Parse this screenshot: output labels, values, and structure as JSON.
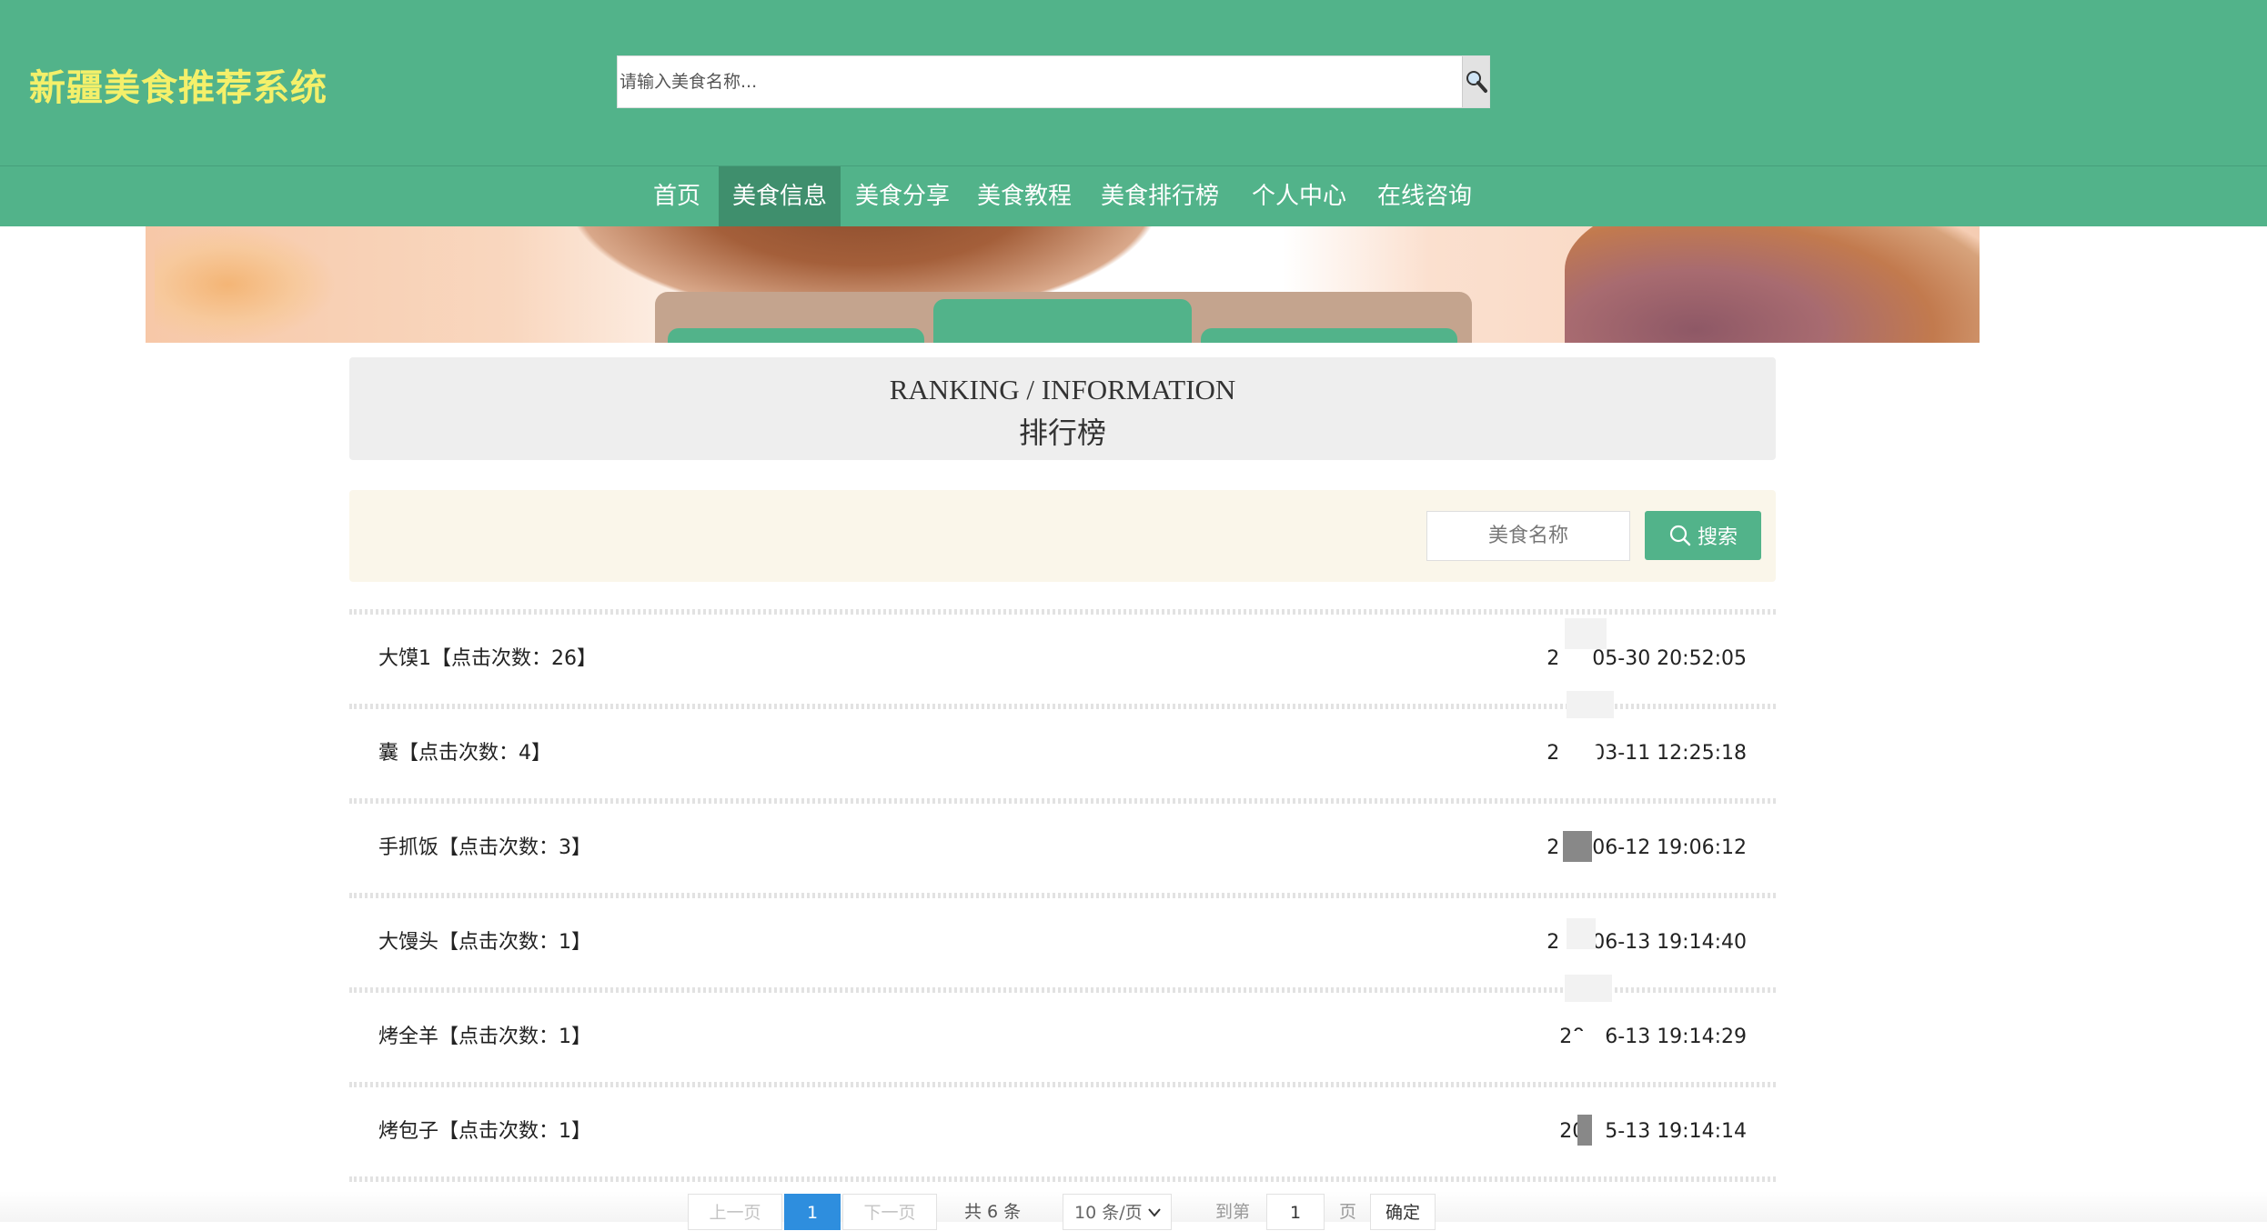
{
  "header": {
    "site_title": "新疆美食推荐系统",
    "search_placeholder": "请输入美食名称..."
  },
  "nav": {
    "items": [
      {
        "label": "首页"
      },
      {
        "label": "美食信息",
        "active": true
      },
      {
        "label": "美食分享"
      },
      {
        "label": "美食教程"
      },
      {
        "label": "美食排行榜"
      },
      {
        "label": "个人中心"
      },
      {
        "label": "在线咨询"
      }
    ]
  },
  "section": {
    "title_en": "RANKING / INFORMATION",
    "title_cn": "排行榜"
  },
  "filter": {
    "placeholder": "美食名称",
    "button_label": "搜索"
  },
  "list": {
    "rows": [
      {
        "title": "大馍1【点击次数：26】",
        "time_prefix": "2",
        "time_suffix": "05-30 20:52:05"
      },
      {
        "title": "囊【点击次数：4】",
        "time_prefix": "2",
        "time_suffix": "03-11 12:25:18"
      },
      {
        "title": "手抓饭【点击次数：3】",
        "time_prefix": "2",
        "time_suffix": "06-12 19:06:12"
      },
      {
        "title": "大馒头【点击次数：1】",
        "time_prefix": "2",
        "time_suffix": "06-13 19:14:40"
      },
      {
        "title": "烤全羊【点击次数：1】",
        "time_prefix": "20",
        "time_suffix": "6-13 19:14:29"
      },
      {
        "title": "烤包子【点击次数：1】",
        "time_prefix": "20",
        "time_suffix": "5-13 19:14:14"
      }
    ]
  },
  "pagination": {
    "prev_label": "上一页",
    "current_page": "1",
    "next_label": "下一页",
    "total_text": "共 6 条",
    "page_size": "10 条/页",
    "goto_label": "到第",
    "goto_value": "1",
    "page_unit": "页",
    "confirm_label": "确定"
  },
  "colors": {
    "primary": "#52b38a",
    "title_yellow": "#f4f06a",
    "pager_active": "#2e8ede"
  }
}
